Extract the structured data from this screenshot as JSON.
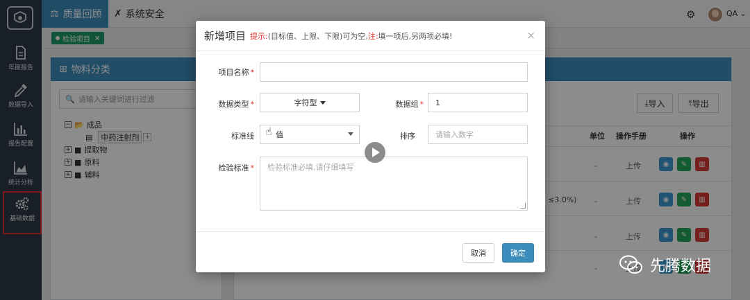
{
  "topbar": {
    "active_nav": "质量回顾",
    "nav_item": "系统安全",
    "user": "QA"
  },
  "sidebar": {
    "items": [
      {
        "label": "年度报告"
      },
      {
        "label": "数据导入"
      },
      {
        "label": "报告配置"
      },
      {
        "label": "统计分析"
      },
      {
        "label": "基础数据"
      }
    ]
  },
  "tabs": [
    {
      "label": "检验项目"
    }
  ],
  "left_panel": {
    "title": "物料分类",
    "filter_placeholder": "请输入关键词进行过滤",
    "tree": [
      {
        "label": "成品",
        "toggle": "−"
      },
      {
        "label": "中药注射剂",
        "toggle": ""
      },
      {
        "label": "提取物",
        "toggle": "+"
      },
      {
        "label": "原料",
        "toggle": "+"
      },
      {
        "label": "辅料",
        "toggle": "+"
      }
    ]
  },
  "right_panel": {
    "import_label": "导入",
    "export_label": "导出",
    "columns": [
      "单位",
      "操作手册",
      "操作"
    ],
    "partial_text": "≤3.0%)",
    "rows": [
      {
        "unit": "-",
        "manual": "上传"
      },
      {
        "unit": "-",
        "manual": "上传"
      },
      {
        "unit": "-",
        "manual": "上传"
      },
      {
        "unit": "-",
        "manual": "上传"
      }
    ]
  },
  "modal": {
    "title": "新增项目",
    "hint_prefix": "提示:",
    "hint_body": "(目标值、上限、下限)可为空,",
    "hint_note": "注:",
    "hint_tail": "填一项后,另两项必填!",
    "close": "×",
    "fields": {
      "name_label": "项目名称",
      "name_value": "",
      "type_label": "数据类型",
      "type_value": "字符型",
      "group_label": "数据组",
      "group_value": "1",
      "std_line_label": "标准线",
      "std_line_value": "值",
      "sort_label": "排序",
      "sort_placeholder": "请输入数字",
      "inspect_label": "检验标准",
      "inspect_placeholder": "检验标准必填,请仔细填写"
    },
    "cancel": "取消",
    "ok": "确定"
  },
  "watermark": {
    "text": "先腾数据"
  }
}
